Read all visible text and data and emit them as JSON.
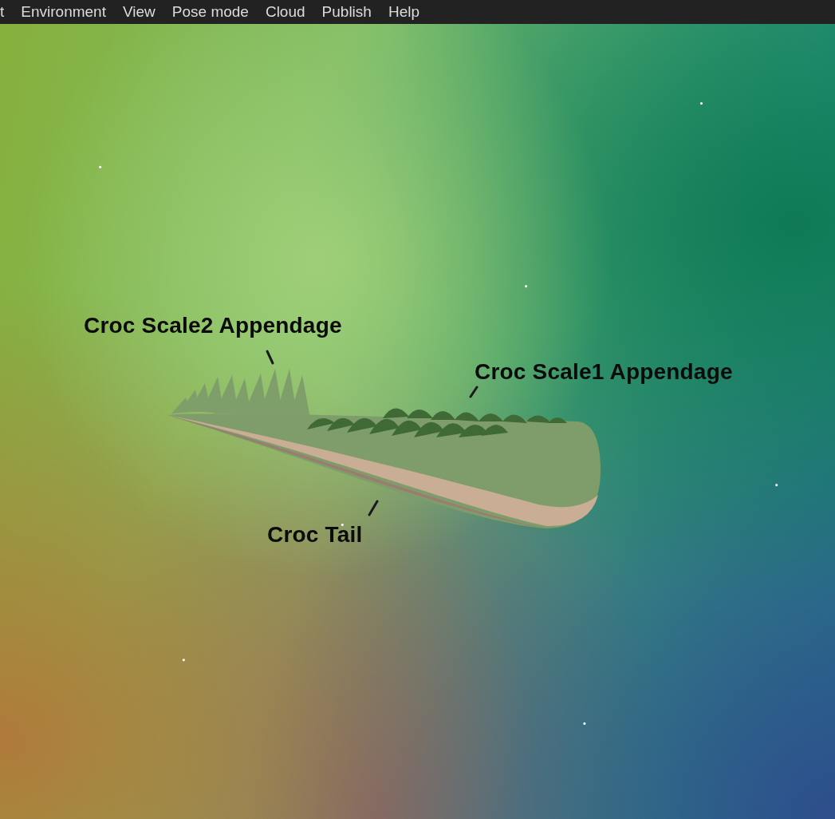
{
  "menu_bar": {
    "items": [
      {
        "label": "t"
      },
      {
        "label": "Environment"
      },
      {
        "label": "View"
      },
      {
        "label": "Pose mode"
      },
      {
        "label": "Cloud"
      },
      {
        "label": "Publish"
      },
      {
        "label": "Help"
      }
    ]
  },
  "viewport": {
    "part_labels": [
      {
        "text": "Croc Scale2 Appendage"
      },
      {
        "text": "Croc Scale1 Appendage"
      },
      {
        "text": "Croc Tail"
      }
    ]
  }
}
